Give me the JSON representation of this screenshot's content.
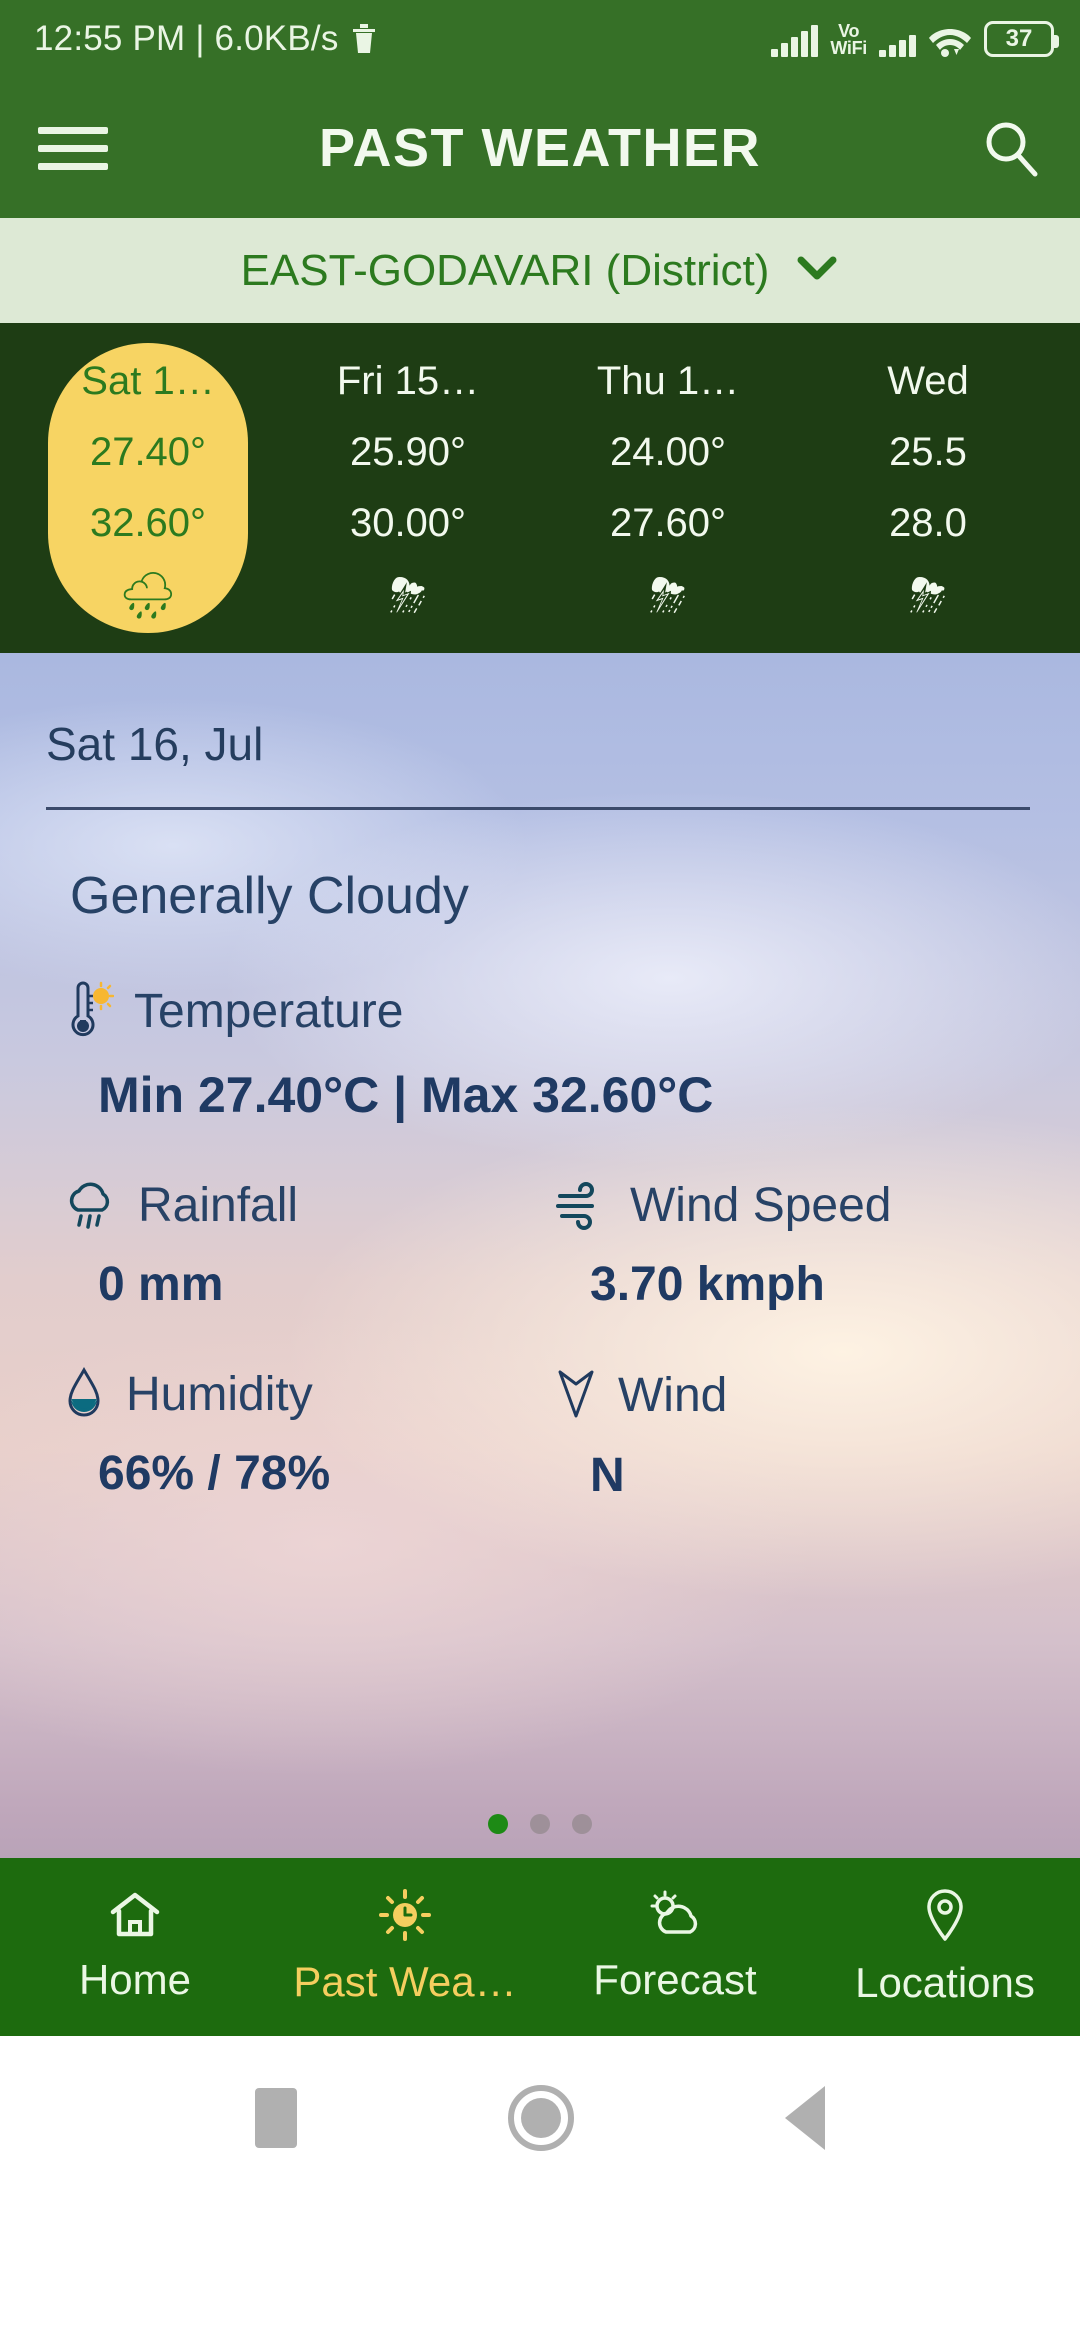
{
  "status_bar": {
    "time_and_net": "12:55 PM | 6.0KB/s",
    "trash_icon": "trash-icon",
    "vo_wifi_line1": "Vo",
    "vo_wifi_line2": "WiFi",
    "battery_level": "37"
  },
  "app_bar": {
    "menu_icon": "hamburger-menu-icon",
    "title": "PAST WEATHER",
    "search_icon": "search-icon"
  },
  "district": {
    "label": "EAST-GODAVARI (District)",
    "chevron": "⌄",
    "accent_color": "#2c7a1f"
  },
  "carousel": {
    "background_color": "#1e3d14",
    "selected_pill_color": "#f7d463",
    "days": [
      {
        "name": "Sat 1…",
        "min": "27.40°",
        "max": "32.60°",
        "icon": "🌧",
        "icon_name": "rain-cloud-icon",
        "selected": true
      },
      {
        "name": "Fri 15…",
        "min": "25.90°",
        "max": "30.00°",
        "icon": "⛈",
        "icon_name": "thunderstorm-icon",
        "selected": false
      },
      {
        "name": "Thu 1…",
        "min": "24.00°",
        "max": "27.60°",
        "icon": "⛈",
        "icon_name": "thunderstorm-icon",
        "selected": false
      },
      {
        "name": "Wed",
        "min": "25.5",
        "max": "28.0",
        "icon": "⛈",
        "icon_name": "thunderstorm-icon",
        "selected": false
      }
    ]
  },
  "detail": {
    "date": "Sat 16, Jul",
    "summary": "Generally Cloudy",
    "temperature": {
      "label": "Temperature",
      "icon_name": "thermometer-sun-icon",
      "value": "Min 27.40°C | Max 32.60°C"
    },
    "rainfall": {
      "label": "Rainfall",
      "icon_name": "cloud-rain-icon",
      "value": "0 mm"
    },
    "wind_speed": {
      "label": "Wind Speed",
      "icon_name": "wind-icon",
      "value": "3.70 kmph"
    },
    "humidity": {
      "label": "Humidity",
      "icon_name": "water-drop-icon",
      "value": "66% / 78%"
    },
    "wind": {
      "label": "Wind",
      "icon_name": "wind-direction-arrow-icon",
      "value": "N"
    },
    "pager": {
      "total": 3,
      "active_index": 0,
      "active_color": "#1d8a15"
    }
  },
  "bottom_nav": {
    "background_color": "#1d6b0e",
    "active_color": "#f5ce5f",
    "items": [
      {
        "label": "Home",
        "icon_name": "home-icon",
        "active": false
      },
      {
        "label": "Past Wea…",
        "icon_name": "sun-clock-icon",
        "active": true
      },
      {
        "label": "Forecast",
        "icon_name": "sun-behind-cloud-icon",
        "active": false
      },
      {
        "label": "Locations",
        "icon_name": "map-pin-icon",
        "active": false
      }
    ]
  },
  "android_nav": {
    "recents_icon": "recents-square-icon",
    "home_icon": "home-circle-icon",
    "back_icon": "back-triangle-icon"
  }
}
